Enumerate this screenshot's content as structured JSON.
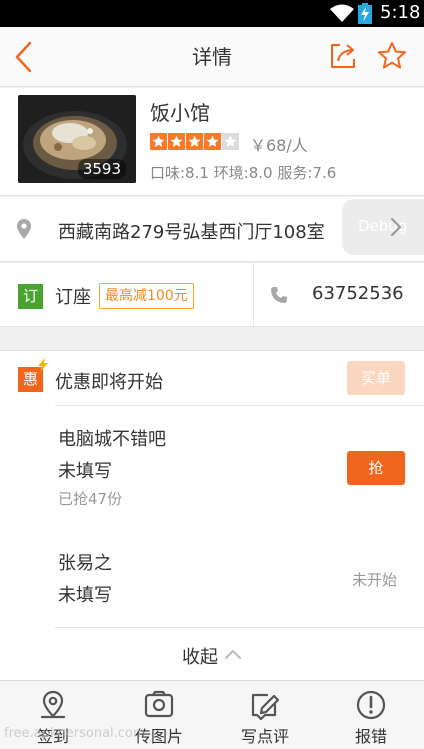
{
  "status_bar": {
    "time": "5:18"
  },
  "nav": {
    "title": "详情"
  },
  "shop": {
    "name": "饭小馆",
    "photo_count": "3593",
    "rating_stars": 4,
    "rating_max": 5,
    "price": "￥68/人",
    "scores": "口味:8.1  环境:8.0  服务:7.6"
  },
  "address": {
    "text": "西藏南路279号弘基西门厅108室",
    "debug_label": "Debug"
  },
  "booking": {
    "icon_char": "订",
    "label": "订座",
    "promo": "最高减100元",
    "phone": "63752536"
  },
  "deals": {
    "icon_char": "惠",
    "title": "优惠即将开始",
    "buy_label": "买单",
    "items": [
      {
        "name": "电脑城不错吧",
        "subtitle": "未填写",
        "sold": "已抢47份",
        "action": "抢"
      },
      {
        "name": "张易之",
        "subtitle": "未填写",
        "status": "未开始"
      }
    ],
    "collapse_label": "收起"
  },
  "tabs": [
    {
      "label": "签到"
    },
    {
      "label": "传图片"
    },
    {
      "label": "写点评"
    },
    {
      "label": "报错"
    }
  ],
  "watermark": "free.apkpersonal.com",
  "colors": {
    "accent": "#f2651c",
    "green": "#4aa32f",
    "star": "#f57a2b",
    "promo": "#f08a1c"
  }
}
